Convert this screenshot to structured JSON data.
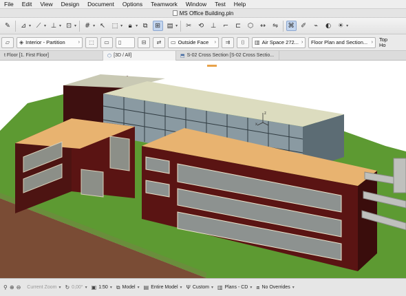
{
  "menubar": {
    "items": [
      "File",
      "Edit",
      "View",
      "Design",
      "Document",
      "Options",
      "Teamwork",
      "Window",
      "Test",
      "Help"
    ]
  },
  "titlebar": {
    "title": "MS Office Building.pln"
  },
  "infobox": {
    "layer": "Interior - Partition",
    "face": "Outside Face",
    "composite": "Air Space 272...",
    "view_setting": "Floor Plan and Section...",
    "top_label": "Top",
    "home_label": "Ho"
  },
  "tabs": {
    "floor": "t Floor [1. First Floor]",
    "view3d": "[3D / All]",
    "section": "S-02 Cross Section [S-02 Cross Sectio..."
  },
  "statusbar": {
    "zoom": "Current Zoom",
    "angle": "0,00°",
    "scale": "1:50",
    "model_view": "Model",
    "filter": "Entire Model",
    "pen_set": "Custom",
    "mvo": "Plans - CD",
    "override": "No Overrides"
  },
  "colors": {
    "grass": "#5d9a32",
    "roof": "#e8b370",
    "wall_red": "#5a1413",
    "glass": "#7b8e96",
    "toolbar": "#e6e6e6"
  }
}
